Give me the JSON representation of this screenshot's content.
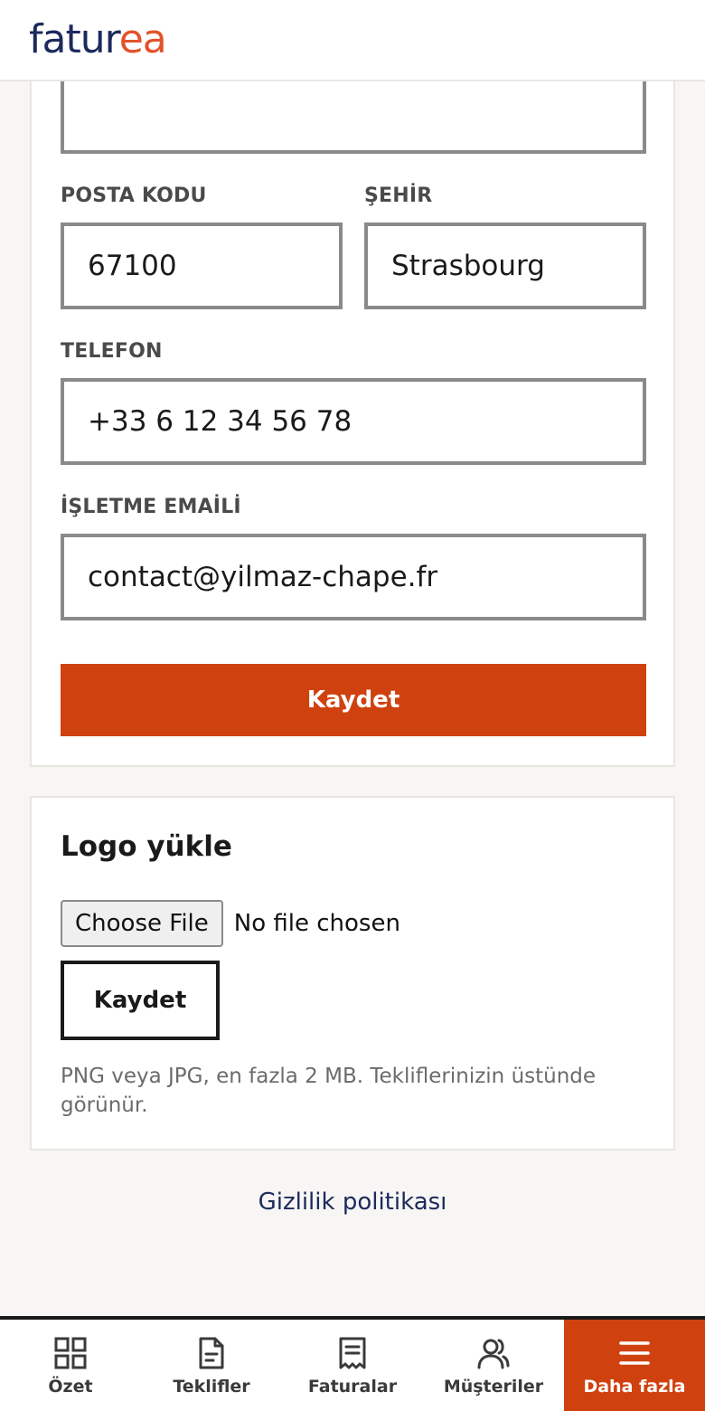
{
  "brand": {
    "part1": "fatur",
    "part2": "ea"
  },
  "form": {
    "postal_code_label": "POSTA KODU",
    "postal_code_value": "67100",
    "city_label": "ŞEHİR",
    "city_value": "Strasbourg",
    "phone_label": "TELEFON",
    "phone_value": "+33 6 12 34 56 78",
    "email_label": "İŞLETME EMAİLİ",
    "email_value": "contact@yilmaz-chape.fr",
    "save_label": "Kaydet"
  },
  "logo_upload": {
    "title": "Logo yükle",
    "choose_file_label": "Choose File",
    "file_status": "No file chosen",
    "save_label": "Kaydet",
    "hint": "PNG veya JPG, en fazla 2 MB. Tekliflerinizin üstünde görünür."
  },
  "footer": {
    "privacy_link": "Gizlilik politikası"
  },
  "bottom_nav": {
    "items": [
      {
        "label": "Özet",
        "icon": "grid-icon"
      },
      {
        "label": "Teklifler",
        "icon": "document-icon"
      },
      {
        "label": "Faturalar",
        "icon": "receipt-icon"
      },
      {
        "label": "Müşteriler",
        "icon": "users-icon"
      },
      {
        "label": "Daha fazla",
        "icon": "menu-icon",
        "active": true
      }
    ]
  },
  "colors": {
    "accent": "#cf4210",
    "brand_dark": "#1c2a5c",
    "brand_orange": "#e2532a"
  }
}
